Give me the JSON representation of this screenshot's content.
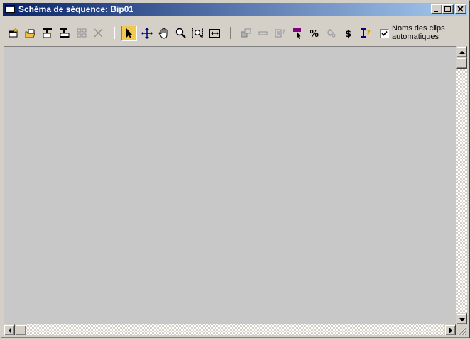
{
  "window": {
    "title": "Schéma de séquence: Bip01",
    "controls": [
      "minimize-icon",
      "maximize-icon",
      "close-icon"
    ]
  },
  "toolbar": {
    "tools": [
      {
        "name": "create-clip-icon",
        "enabled": true
      },
      {
        "name": "open-clip-icon",
        "enabled": true
      },
      {
        "name": "insert-before-icon",
        "enabled": true
      },
      {
        "name": "insert-after-icon",
        "enabled": true
      },
      {
        "name": "replace-icon",
        "enabled": false
      },
      {
        "name": "delete-icon",
        "enabled": false
      },
      {
        "name": "select-icon",
        "enabled": true,
        "active": true
      },
      {
        "name": "move-icon",
        "enabled": true
      },
      {
        "name": "pan-icon",
        "enabled": true
      },
      {
        "name": "zoom-icon",
        "enabled": true
      },
      {
        "name": "zoom-region-icon",
        "enabled": true
      },
      {
        "name": "zoom-extents-icon",
        "enabled": true
      },
      {
        "name": "set-start-icon",
        "enabled": false
      },
      {
        "name": "blank-icon",
        "enabled": false
      },
      {
        "name": "clip-info-icon",
        "enabled": false
      },
      {
        "name": "select-marker-icon",
        "enabled": true
      },
      {
        "name": "percent-icon",
        "enabled": true
      },
      {
        "name": "optimize-icon",
        "enabled": false
      },
      {
        "name": "dollar-icon",
        "enabled": true
      },
      {
        "name": "transition-info-icon",
        "enabled": true
      }
    ],
    "auto_clip_names": {
      "checked": true,
      "label_line1": "Noms des clips",
      "label_line2": "automatiques"
    }
  },
  "colors": {
    "titlebar_start": "#0a246a",
    "titlebar_end": "#a6caf0",
    "face": "#d4d0c8",
    "canvas": "#c8c8c8",
    "active_tool": "#f2c94c"
  }
}
